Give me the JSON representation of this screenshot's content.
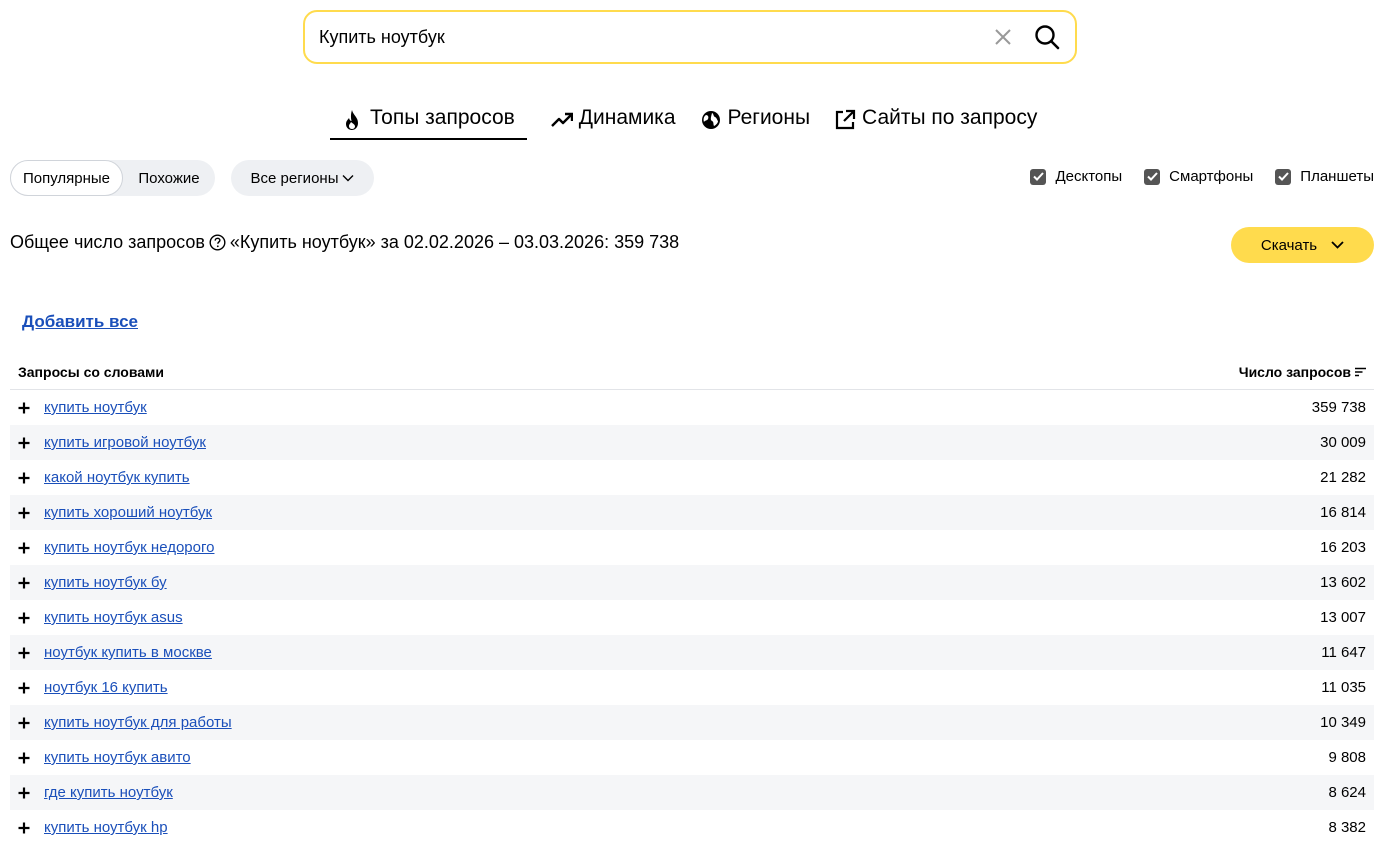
{
  "search": {
    "value": "Купить ноутбук"
  },
  "tabs": [
    {
      "label": "Топы запросов",
      "icon": "fire-icon",
      "active": true
    },
    {
      "label": "Динамика",
      "icon": "trend-icon"
    },
    {
      "label": "Регионы",
      "icon": "globe-icon"
    },
    {
      "label": "Сайты по запросу",
      "icon": "external-link-icon"
    }
  ],
  "filters": {
    "seg_popular": "Популярные",
    "seg_similar": "Похожие",
    "regions": "Все регионы",
    "devices": [
      {
        "label": "Десктопы",
        "checked": true
      },
      {
        "label": "Смартфоны",
        "checked": true
      },
      {
        "label": "Планшеты",
        "checked": true
      }
    ]
  },
  "summary": {
    "label": "Общее число запросов",
    "text": "«Купить ноутбук» за 02.02.2026 – 03.03.2026: 359 738"
  },
  "download_label": "Скачать",
  "add_all_label": "Добавить все",
  "table": {
    "col_phrase": "Запросы со словами",
    "col_count": "Число запросов",
    "rows": [
      {
        "phrase": "купить ноутбук",
        "count": "359 738"
      },
      {
        "phrase": "купить игровой ноутбук",
        "count": "30 009"
      },
      {
        "phrase": "какой ноутбук купить",
        "count": "21 282"
      },
      {
        "phrase": "купить хороший ноутбук",
        "count": "16 814"
      },
      {
        "phrase": "купить ноутбук недорого",
        "count": "16 203"
      },
      {
        "phrase": "купить ноутбук бу",
        "count": "13 602"
      },
      {
        "phrase": "купить ноутбук asus",
        "count": "13 007"
      },
      {
        "phrase": "ноутбук купить в москве",
        "count": "11 647"
      },
      {
        "phrase": "ноутбук 16 купить",
        "count": "11 035"
      },
      {
        "phrase": "купить ноутбук для работы",
        "count": "10 349"
      },
      {
        "phrase": "купить ноутбук авито",
        "count": "9 808"
      },
      {
        "phrase": "где купить ноутбук",
        "count": "8 624"
      },
      {
        "phrase": "купить ноутбук hp",
        "count": "8 382"
      }
    ]
  }
}
